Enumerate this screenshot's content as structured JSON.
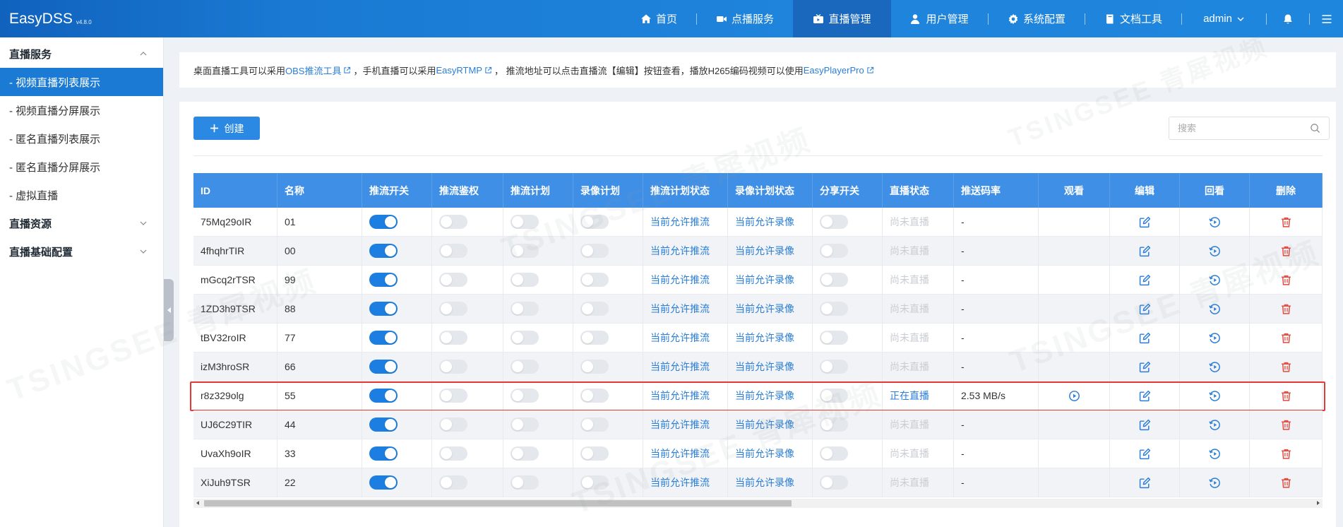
{
  "app": {
    "logo": "EasyDSS",
    "version": "v4.8.0"
  },
  "nav": {
    "items": [
      {
        "label": "首页",
        "icon": "home-icon"
      },
      {
        "label": "点播服务",
        "icon": "video-camera-icon"
      },
      {
        "label": "直播管理",
        "icon": "live-tv-icon",
        "active": true
      },
      {
        "label": "用户管理",
        "icon": "user-icon"
      },
      {
        "label": "系统配置",
        "icon": "gear-icon"
      },
      {
        "label": "文档工具",
        "icon": "book-icon"
      }
    ],
    "user": "admin"
  },
  "sidebar": {
    "sections": [
      {
        "title": "直播服务",
        "expanded": true,
        "items": [
          {
            "label": "- 视频直播列表展示",
            "active": true
          },
          {
            "label": "- 视频直播分屏展示"
          },
          {
            "label": "- 匿名直播列表展示"
          },
          {
            "label": "- 匿名直播分屏展示"
          },
          {
            "label": "- 虚拟直播"
          }
        ]
      },
      {
        "title": "直播资源",
        "expanded": false
      },
      {
        "title": "直播基础配置",
        "expanded": false
      }
    ]
  },
  "notice": {
    "part1": "桌面直播工具可以采用 ",
    "link1": "OBS推流工具",
    "part2": "，手机直播可以采用 ",
    "link2": "EasyRTMP",
    "part3": "，  推流地址可以点击直播流【编辑】按钮查看，播放H265编码视频可以使用 ",
    "link3": "EasyPlayerPro"
  },
  "toolbar": {
    "create_label": "创建",
    "search_placeholder": "搜索"
  },
  "table": {
    "columns": [
      "ID",
      "名称",
      "推流开关",
      "推流鉴权",
      "推流计划",
      "录像计划",
      "推流计划状态",
      "录像计划状态",
      "分享开关",
      "直播状态",
      "推送码率",
      "观看",
      "编辑",
      "回看",
      "删除"
    ],
    "rows": [
      {
        "id": "75Mq29oIR",
        "name": "01",
        "push_switch": true,
        "push_auth": false,
        "push_plan": false,
        "record_plan": false,
        "push_plan_status": "当前允许推流",
        "record_plan_status": "当前允许录像",
        "share_switch": false,
        "live_status": "尚未直播",
        "bitrate": "-",
        "live": false
      },
      {
        "id": "4fhqhrTIR",
        "name": "00",
        "push_switch": true,
        "push_auth": false,
        "push_plan": false,
        "record_plan": false,
        "push_plan_status": "当前允许推流",
        "record_plan_status": "当前允许录像",
        "share_switch": false,
        "live_status": "尚未直播",
        "bitrate": "-",
        "live": false
      },
      {
        "id": "mGcq2rTSR",
        "name": "99",
        "push_switch": true,
        "push_auth": false,
        "push_plan": false,
        "record_plan": false,
        "push_plan_status": "当前允许推流",
        "record_plan_status": "当前允许录像",
        "share_switch": false,
        "live_status": "尚未直播",
        "bitrate": "-",
        "live": false
      },
      {
        "id": "1ZD3h9TSR",
        "name": "88",
        "push_switch": true,
        "push_auth": false,
        "push_plan": false,
        "record_plan": false,
        "push_plan_status": "当前允许推流",
        "record_plan_status": "当前允许录像",
        "share_switch": false,
        "live_status": "尚未直播",
        "bitrate": "-",
        "live": false
      },
      {
        "id": "tBV32roIR",
        "name": "77",
        "push_switch": true,
        "push_auth": false,
        "push_plan": false,
        "record_plan": false,
        "push_plan_status": "当前允许推流",
        "record_plan_status": "当前允许录像",
        "share_switch": false,
        "live_status": "尚未直播",
        "bitrate": "-",
        "live": false
      },
      {
        "id": "izM3hroSR",
        "name": "66",
        "push_switch": true,
        "push_auth": false,
        "push_plan": false,
        "record_plan": false,
        "push_plan_status": "当前允许推流",
        "record_plan_status": "当前允许录像",
        "share_switch": false,
        "live_status": "尚未直播",
        "bitrate": "-",
        "live": false
      },
      {
        "id": "r8z329olg",
        "name": "55",
        "push_switch": true,
        "push_auth": false,
        "push_plan": false,
        "record_plan": false,
        "push_plan_status": "当前允许推流",
        "record_plan_status": "当前允许录像",
        "share_switch": false,
        "live_status": "正在直播",
        "bitrate": "2.53 MB/s",
        "live": true,
        "highlighted": true
      },
      {
        "id": "UJ6C29TIR",
        "name": "44",
        "push_switch": true,
        "push_auth": false,
        "push_plan": false,
        "record_plan": false,
        "push_plan_status": "当前允许推流",
        "record_plan_status": "当前允许录像",
        "share_switch": false,
        "live_status": "尚未直播",
        "bitrate": "-",
        "live": false
      },
      {
        "id": "UvaXh9oIR",
        "name": "33",
        "push_switch": true,
        "push_auth": false,
        "push_plan": false,
        "record_plan": false,
        "push_plan_status": "当前允许推流",
        "record_plan_status": "当前允许录像",
        "share_switch": false,
        "live_status": "尚未直播",
        "bitrate": "-",
        "live": false
      },
      {
        "id": "XiJuh9TSR",
        "name": "22",
        "push_switch": true,
        "push_auth": false,
        "push_plan": false,
        "record_plan": false,
        "push_plan_status": "当前允许推流",
        "record_plan_status": "当前允许录像",
        "share_switch": false,
        "live_status": "尚未直播",
        "bitrate": "-",
        "live": false
      }
    ]
  },
  "colors": {
    "header": "#1f84dc",
    "header_active": "#1a68bd",
    "accent": "#2a7ed7",
    "table_header": "#3f8fe6",
    "danger": "#e5483d",
    "highlight": "#e53935"
  },
  "watermark": {
    "text": "TSINGSEE 青犀视频"
  }
}
